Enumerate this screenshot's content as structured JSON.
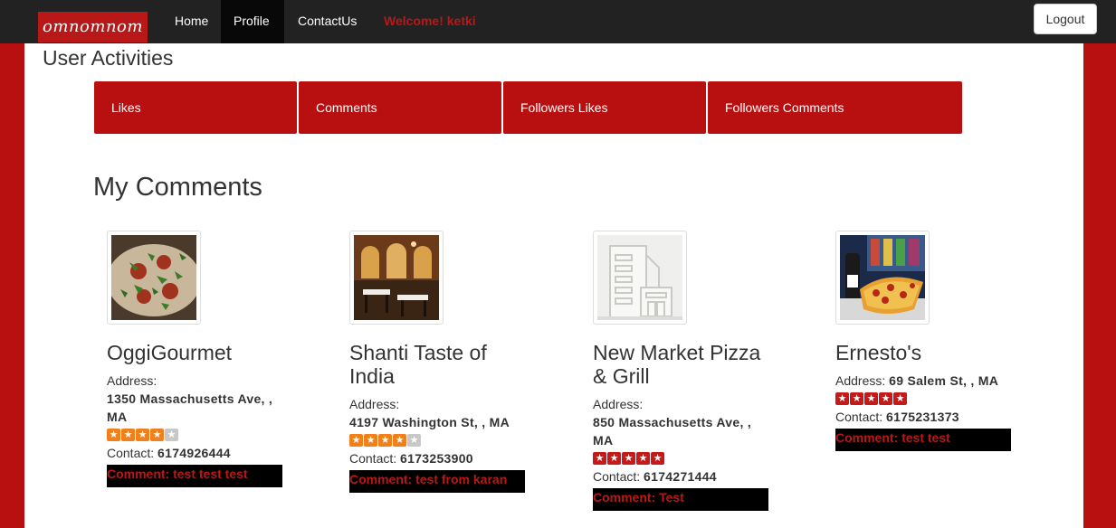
{
  "navbar": {
    "brand": "omnomnom",
    "links": [
      {
        "label": "Home"
      },
      {
        "label": "Profile"
      },
      {
        "label": "ContactUs"
      }
    ],
    "welcome": "Welcome! ketki",
    "logout_label": "Logout"
  },
  "page": {
    "title": "User Activities",
    "tabs": [
      {
        "label": "Likes"
      },
      {
        "label": "Comments"
      },
      {
        "label": "Followers Likes"
      },
      {
        "label": "Followers Comments"
      }
    ],
    "section_title": "My Comments"
  },
  "colors": {
    "accent": "#b81010",
    "navbar": "#222222",
    "star_orange": "#f07f1c",
    "star_red": "#c41a1a"
  },
  "cards": [
    {
      "name": "OggiGourmet",
      "address_label": "Address:",
      "address": "1350 Massachusetts Ave, , MA",
      "rating": 4,
      "contact_label": "Contact:",
      "contact": "6174926444",
      "comment": "Comment: test test test",
      "image_icon": "pizza-photo"
    },
    {
      "name": "Shanti Taste of India",
      "address_label": "Address:",
      "address": "4197 Washington St, , MA",
      "rating": 4,
      "contact_label": "Contact:",
      "contact": "6173253900",
      "comment": "Comment: test from karan",
      "image_icon": "restaurant-interior-photo"
    },
    {
      "name": "New Market Pizza & Grill",
      "address_label": "Address:",
      "address": "850 Massachusetts Ave, , MA",
      "rating": 5,
      "contact_label": "Contact:",
      "contact": "6174271444",
      "comment": "Comment: Test",
      "image_icon": "building-placeholder-icon"
    },
    {
      "name": "Ernesto's",
      "address_label": "Address:",
      "address": "69 Salem St, , MA",
      "rating": 5,
      "contact_label": "Contact:",
      "contact": "6175231373",
      "comment": "Comment: test test",
      "image_icon": "pizza-beer-photo"
    }
  ]
}
